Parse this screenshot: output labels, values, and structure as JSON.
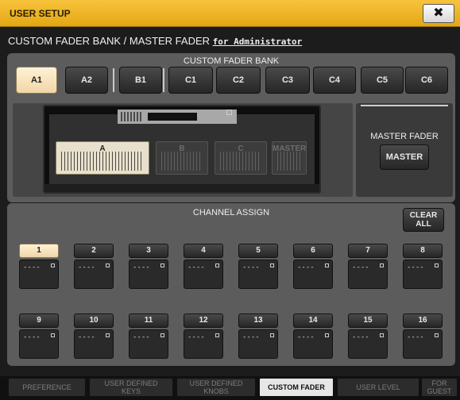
{
  "window": {
    "title": "USER SETUP",
    "close_icon": "✖"
  },
  "heading": {
    "text": "CUSTOM FADER BANK / MASTER FADER ",
    "link": "for Administrator"
  },
  "bank": {
    "label": "CUSTOM FADER BANK",
    "buttons": [
      {
        "label": "A1",
        "active": true
      },
      {
        "label": "A2",
        "active": false
      },
      {
        "label": "B1",
        "active": false
      },
      {
        "label": "C1",
        "active": false
      },
      {
        "label": "C2",
        "active": false
      },
      {
        "label": "C3",
        "active": false
      },
      {
        "label": "C4",
        "active": false
      },
      {
        "label": "C5",
        "active": false
      },
      {
        "label": "C6",
        "active": false
      }
    ]
  },
  "console": {
    "sections": {
      "a": "A",
      "b": "B",
      "c": "C",
      "master": "MASTER"
    }
  },
  "master_fader": {
    "label": "MASTER FADER",
    "button": "MASTER"
  },
  "assign": {
    "label": "CHANNEL ASSIGN",
    "clear_line1": "CLEAR",
    "clear_line2": "ALL",
    "channels": [
      {
        "num": "1",
        "value": "----",
        "active": true
      },
      {
        "num": "2",
        "value": "----"
      },
      {
        "num": "3",
        "value": "----"
      },
      {
        "num": "4",
        "value": "----"
      },
      {
        "num": "5",
        "value": "----"
      },
      {
        "num": "6",
        "value": "----"
      },
      {
        "num": "7",
        "value": "----"
      },
      {
        "num": "8",
        "value": "----"
      },
      {
        "num": "9",
        "value": "----"
      },
      {
        "num": "10",
        "value": "----"
      },
      {
        "num": "11",
        "value": "----"
      },
      {
        "num": "12",
        "value": "----"
      },
      {
        "num": "13",
        "value": "----"
      },
      {
        "num": "14",
        "value": "----"
      },
      {
        "num": "15",
        "value": "----"
      },
      {
        "num": "16",
        "value": "----"
      }
    ]
  },
  "tabs": [
    {
      "line1": "PREFERENCE",
      "line2": ""
    },
    {
      "line1": "USER DEFINED",
      "line2": "KEYS"
    },
    {
      "line1": "USER DEFINED",
      "line2": "KNOBS"
    },
    {
      "line1": "CUSTOM FADER",
      "line2": "",
      "active": true
    },
    {
      "line1": "USER LEVEL",
      "line2": ""
    },
    {
      "line1": "FOR",
      "line2": "GUEST"
    }
  ]
}
